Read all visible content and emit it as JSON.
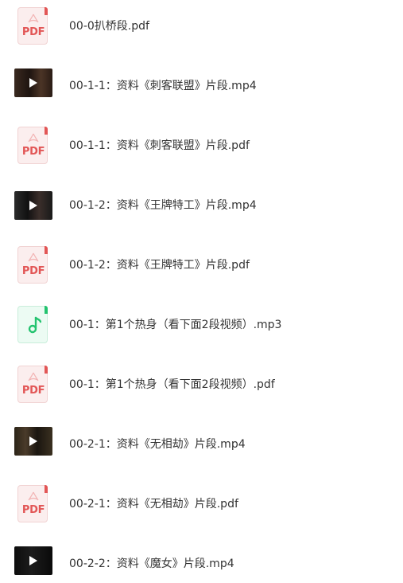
{
  "files": [
    {
      "name": "00-0扒桥段.pdf",
      "type": "pdf",
      "icon_label": "PDF"
    },
    {
      "name": "00-1-1：资料《刺客联盟》片段.mp4",
      "type": "video"
    },
    {
      "name": "00-1-1：资料《刺客联盟》片段.pdf",
      "type": "pdf",
      "icon_label": "PDF"
    },
    {
      "name": "00-1-2：资料《王牌特工》片段.mp4",
      "type": "video"
    },
    {
      "name": "00-1-2：资料《王牌特工》片段.pdf",
      "type": "pdf",
      "icon_label": "PDF"
    },
    {
      "name": "00-1：第1个热身（看下面2段视频）.mp3",
      "type": "audio"
    },
    {
      "name": "00-1：第1个热身（看下面2段视频）.pdf",
      "type": "pdf",
      "icon_label": "PDF"
    },
    {
      "name": "00-2-1：资料《无相劫》片段.mp4",
      "type": "video"
    },
    {
      "name": "00-2-1：资料《无相劫》片段.pdf",
      "type": "pdf",
      "icon_label": "PDF"
    },
    {
      "name": "00-2-2：资料《魔女》片段.mp4",
      "type": "video"
    }
  ],
  "colors": {
    "pdf_accent": "#e25656",
    "audio_accent": "#23c36f",
    "text": "#333333"
  }
}
